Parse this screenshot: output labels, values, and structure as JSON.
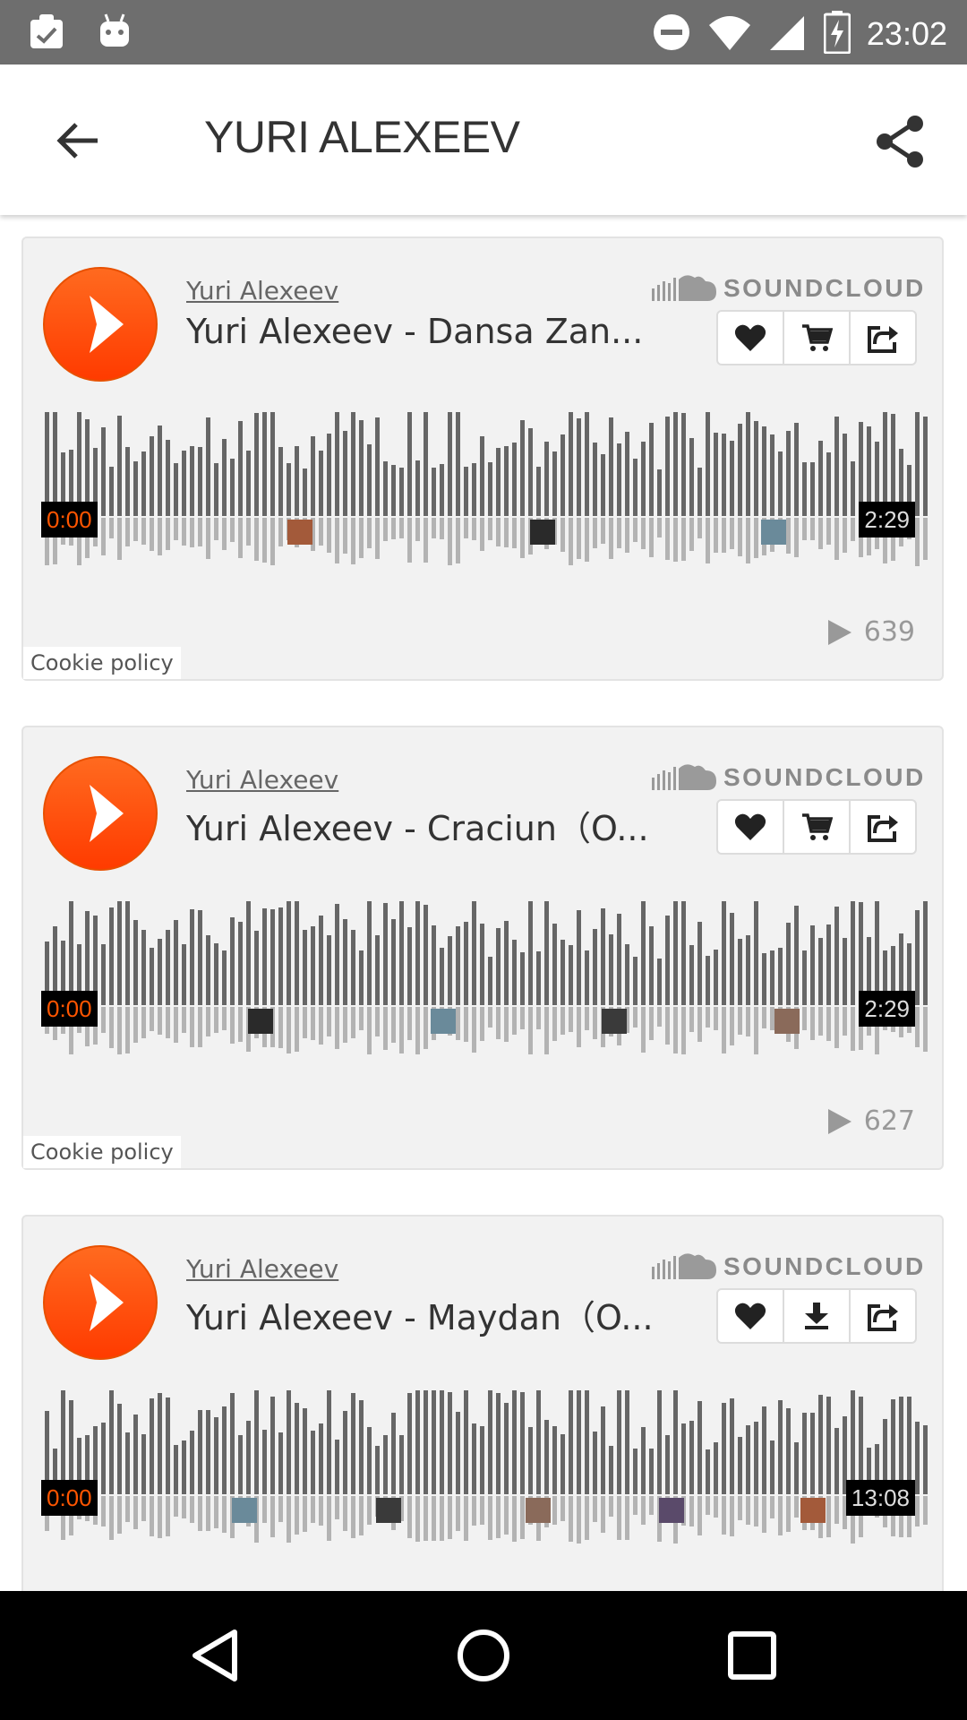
{
  "status_bar": {
    "time": "23:02",
    "left_icons": [
      "clipboard-check-icon",
      "android-icon"
    ],
    "right_icons": [
      "do-not-disturb-icon",
      "wifi-icon",
      "signal-icon",
      "battery-charging-icon"
    ]
  },
  "app_bar": {
    "title": "YURI ALEXEEV",
    "back_icon": "arrow-left-icon",
    "share_icon": "share-icon"
  },
  "colors": {
    "accent": "#ff5500",
    "status_bar": "#6e6e6e",
    "wave_played": "#666666",
    "wave_reflection": "#b3b3b3",
    "card_bg": "#f2f2f2"
  },
  "brand": "SOUNDCLOUD",
  "cookie_label": "Cookie policy",
  "tracks": [
    {
      "artist": "Yuri Alexeev",
      "title": "Yuri Alexeev - Dansa Zan...",
      "current_time": "0:00",
      "duration": "2:29",
      "plays": "639",
      "actions": [
        "heart-icon",
        "cart-icon",
        "share-out-icon"
      ],
      "comment_avatars": 3
    },
    {
      "artist": "Yuri Alexeev",
      "title": "Yuri Alexeev - Craciun（O...",
      "current_time": "0:00",
      "duration": "2:29",
      "plays": "627",
      "actions": [
        "heart-icon",
        "cart-icon",
        "share-out-icon"
      ],
      "comment_avatars": 4
    },
    {
      "artist": "Yuri Alexeev",
      "title": "Yuri Alexeev - Maydan（O...",
      "current_time": "0:00",
      "duration": "13:08",
      "actions": [
        "heart-icon",
        "download-icon",
        "share-out-icon"
      ],
      "comment_avatars": 5
    }
  ],
  "nav_bar": [
    "back-triangle-icon",
    "home-circle-icon",
    "recents-square-icon"
  ]
}
